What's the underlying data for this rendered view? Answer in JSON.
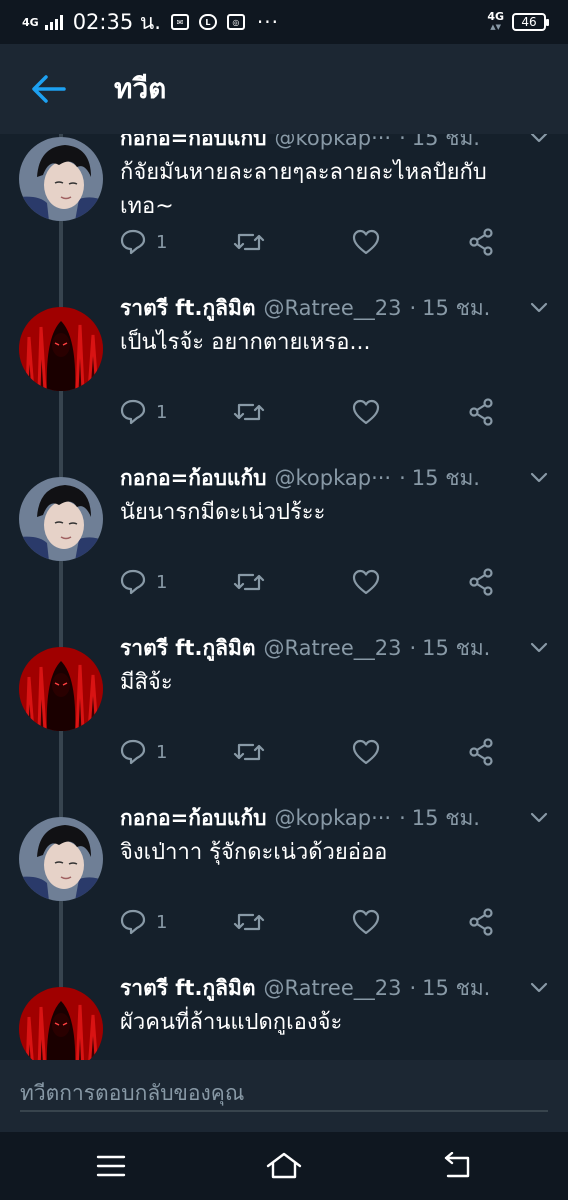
{
  "status_bar": {
    "network": "4G",
    "time": "02:35 น.",
    "network_right": "4G",
    "battery": "46",
    "more": "···"
  },
  "header": {
    "title": "ทวีต",
    "back_icon": "arrow-left-icon"
  },
  "tweets": [
    {
      "name": "กอกอ=ก้อบแก้บ",
      "handle": "@kopkap···",
      "time": "15 ชม.",
      "text": "ก้จัยมันหายละลายๆละลายละไหลปัยกับเทอ~",
      "reply_count": "1",
      "avatar": "boy"
    },
    {
      "name": "ราตรี ft.กูลิมิต",
      "handle": "@Ratree__23",
      "time": "15 ชม.",
      "text": "เป็นไรจ้ะ อยากตายเหรอ...",
      "reply_count": "1",
      "avatar": "ghost"
    },
    {
      "name": "กอกอ=ก้อบแก้บ",
      "handle": "@kopkap···",
      "time": "15 ชม.",
      "text": "นัยนารกมีดะเน่วปร้ะะ",
      "reply_count": "1",
      "avatar": "boy"
    },
    {
      "name": "ราตรี ft.กูลิมิต",
      "handle": "@Ratree__23",
      "time": "15 ชม.",
      "text": "มีสิจ้ะ",
      "reply_count": "1",
      "avatar": "ghost"
    },
    {
      "name": "กอกอ=ก้อบแก้บ",
      "handle": "@kopkap···",
      "time": "15 ชม.",
      "text": "จิงเป่าาา รุ้จักดะเน่วด้วยอ่ออ",
      "reply_count": "1",
      "avatar": "boy"
    },
    {
      "name": "ราตรี ft.กูลิมิต",
      "handle": "@Ratree__23",
      "time": "15 ชม.",
      "text": "ผัวคนที่ล้านแปดกูเองจ้ะ",
      "reply_count": "",
      "avatar": "ghost"
    }
  ],
  "tweet_separator": "·",
  "reply_bar": {
    "placeholder": "ทวีตการตอบกลับของคุณ"
  },
  "colors": {
    "background": "#15202b",
    "header": "#1c2733",
    "accent": "#1da1f2",
    "muted": "#8899a6"
  }
}
